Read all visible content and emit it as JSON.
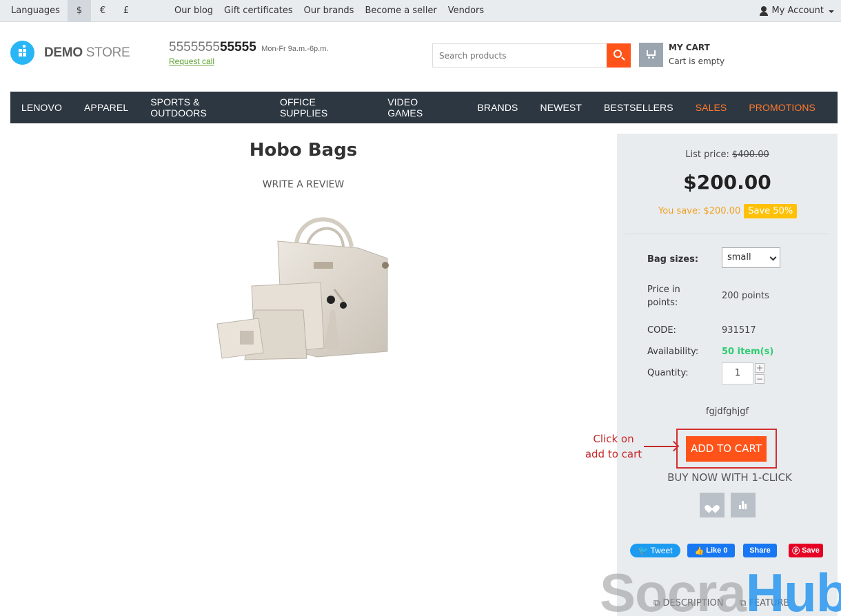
{
  "topbar": {
    "languages": "Languages",
    "currencies": [
      "$",
      "€",
      "£"
    ],
    "links": [
      "Our blog",
      "Gift certificates",
      "Our brands",
      "Become a seller",
      "Vendors"
    ],
    "account": "My Account"
  },
  "header": {
    "logo_bold": "DEMO",
    "logo_light": "STORE",
    "phone_prefix": "5555555",
    "phone_bold": "55555",
    "hours": "Mon-Fr 9a.m.-6p.m.",
    "request_call": "Request call",
    "search_placeholder": "Search products",
    "cart_title": "MY CART",
    "cart_status": "Cart is empty"
  },
  "nav": {
    "items": [
      "LENOVO",
      "APPAREL",
      "SPORTS & OUTDOORS",
      "OFFICE SUPPLIES",
      "VIDEO GAMES",
      "BRANDS",
      "NEWEST",
      "BESTSELLERS"
    ],
    "sales": "SALES",
    "promotions": "PROMOTIONS",
    "accent_color": "#ff7a2f"
  },
  "product": {
    "title": "Hobo Bags",
    "write_review": "WRITE A REVIEW",
    "list_price_label": "List price:",
    "list_price": "$400.00",
    "price": "$200.00",
    "you_save": "You save: $200.00",
    "save_badge": "Save 50%",
    "size_label": "Bag sizes:",
    "size_value": "small",
    "points_label_1": "Price in",
    "points_label_2": "points:",
    "points_value": "200 points",
    "code_label": "CODE:",
    "code_value": "931517",
    "availability_label": "Availability:",
    "availability_value": "50 item(s)",
    "quantity_label": "Quantity:",
    "quantity_value": "1",
    "plus": "+",
    "minus": "−",
    "note": "fgjdfghjgf",
    "add_to_cart": "ADD TO CART",
    "buy_one_click": "BUY NOW WITH 1-CLICK"
  },
  "annotation": {
    "line1": "Click on",
    "line2": "add to cart"
  },
  "social": {
    "tweet": "Tweet",
    "like": "Like 0",
    "share": "Share",
    "save": "Save"
  },
  "tabs": {
    "description": "DESCRIPTION",
    "features": "FEATURE"
  },
  "watermark": {
    "part1": "Socra",
    "part2": "Hub"
  },
  "colors": {
    "brand_orange": "#ff5319",
    "nav_bg": "#2d3741",
    "availability_green": "#2ecc71",
    "badge_yellow": "#ffc107"
  }
}
